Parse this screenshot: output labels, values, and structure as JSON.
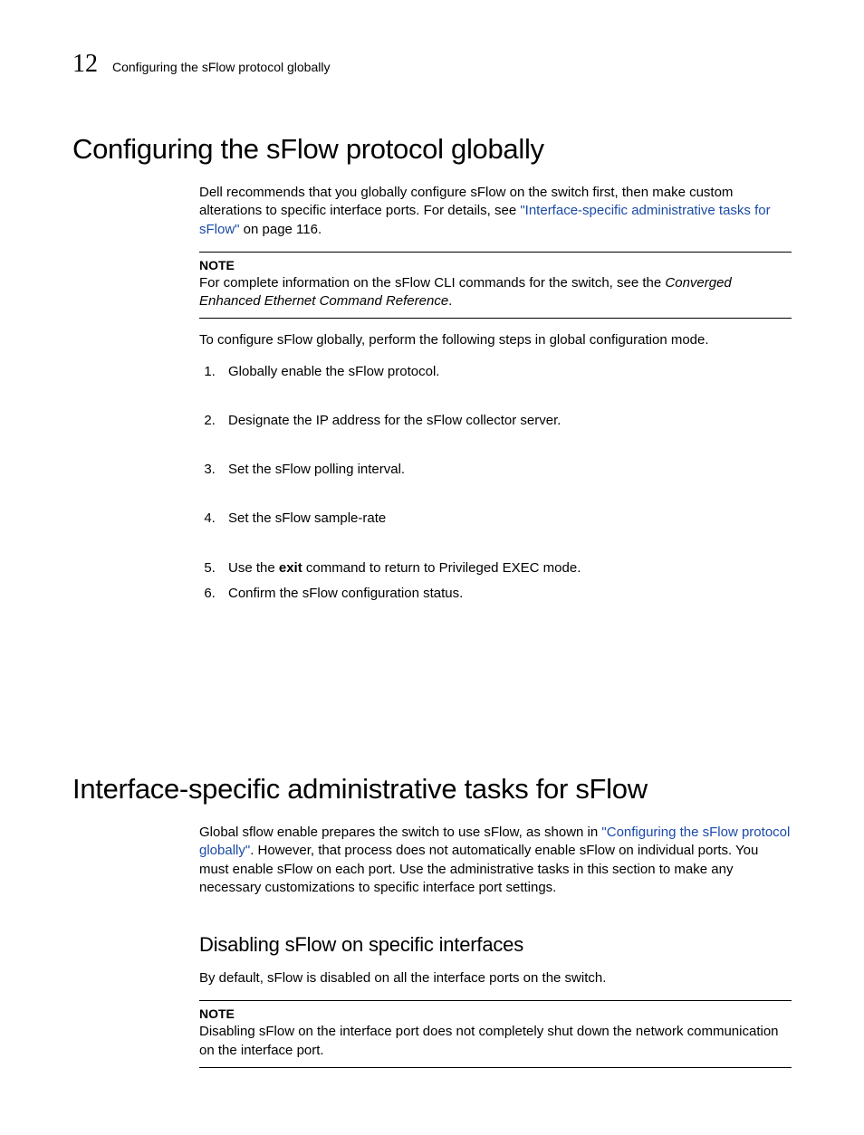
{
  "header": {
    "chapter_number": "12",
    "running_title": "Configuring the sFlow protocol globally"
  },
  "section1": {
    "title": "Configuring the sFlow protocol globally",
    "intro_pre": "Dell recommends that you globally configure sFlow on the switch first, then make custom alterations to specific interface ports. For details, see ",
    "intro_link": "\"Interface-specific administrative tasks for sFlow\"",
    "intro_post": " on page 116.",
    "note_label": "NOTE",
    "note_pre": "For complete information on the sFlow CLI commands for the switch, see the ",
    "note_ital": "Converged Enhanced Ethernet Command Reference",
    "note_post": ".",
    "lead": "To configure sFlow globally, perform the following steps in global configuration mode.",
    "steps": [
      "Globally enable the sFlow protocol.",
      "Designate the IP address for the sFlow collector server.",
      "Set the sFlow polling interval.",
      "Set the sFlow sample-rate"
    ],
    "step5_pre": "Use the ",
    "step5_bold": "exit",
    "step5_post": " command to return to Privileged EXEC mode.",
    "step6": "Confirm the sFlow configuration status."
  },
  "section2": {
    "title": "Interface-specific administrative tasks for sFlow",
    "intro_pre": "Global sflow enable prepares the switch to use sFlow, as shown in ",
    "intro_link": "\"Configuring the sFlow protocol globally\"",
    "intro_post": ". However, that process does not automatically enable sFlow on individual ports. You must enable sFlow on each port. Use the administrative tasks in this section to make any necessary customizations to specific interface port settings.",
    "sub_title": "Disabling sFlow on specific interfaces",
    "sub_intro": "By default, sFlow is disabled on all the interface ports on the switch.",
    "note_label": "NOTE",
    "note_body": "Disabling sFlow on the interface port does not completely shut down the network communication on the interface port."
  }
}
